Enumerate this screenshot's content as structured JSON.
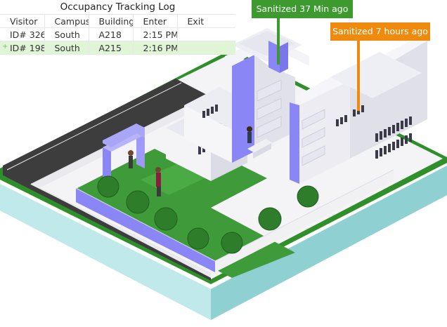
{
  "log": {
    "title": "Occupancy Tracking Log",
    "columns": [
      "Visitor",
      "Campus",
      "Building",
      "Enter",
      "Exit"
    ],
    "rows": [
      {
        "visitor": "ID# 326",
        "campus": "South",
        "building": "A218",
        "enter": "2:15 PM",
        "exit": ""
      },
      {
        "visitor": "ID# 198",
        "campus": "South",
        "building": "A215",
        "enter": "2:16 PM",
        "exit": ""
      }
    ]
  },
  "callouts": {
    "green": {
      "label": "Sanitized 37 Min ago",
      "color": "#3c9a2f"
    },
    "orange": {
      "label": "Sanitized 7 hours ago",
      "color": "#f08a0c"
    }
  },
  "colors": {
    "accent_purple": "#8a86f5",
    "lawn": "#3f9a39",
    "road": "#3d3d3d",
    "water": "#a6dfe0"
  }
}
